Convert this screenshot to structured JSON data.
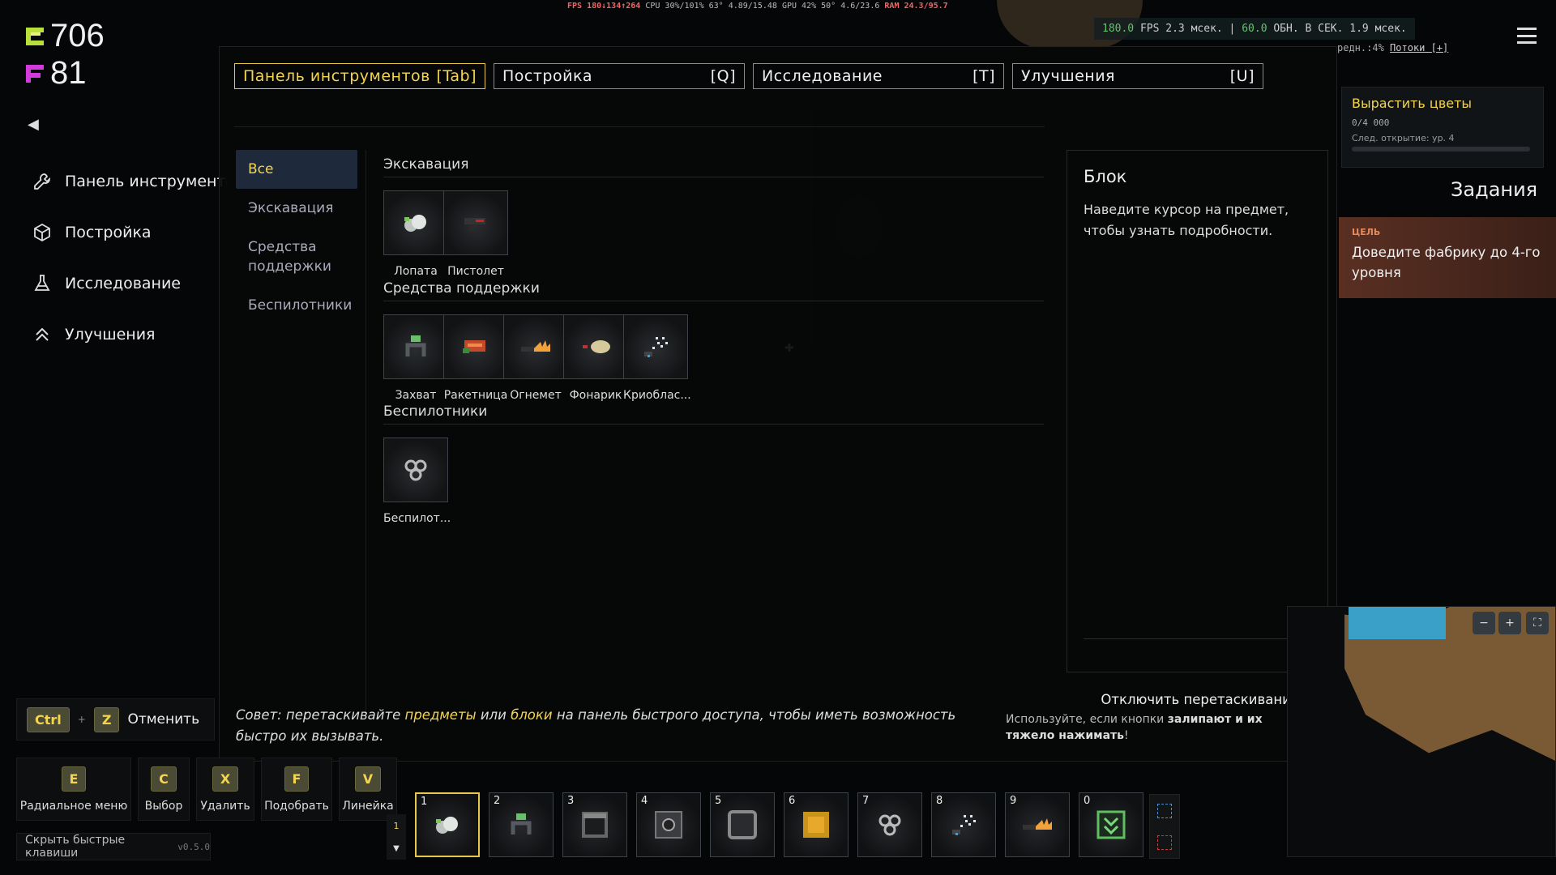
{
  "perf": {
    "fps_line": "FPS 180↓134↑264",
    "cpu_line": "CPU 30%/101% 63°",
    "mem_line": "4.89/15.48",
    "gpu_line": "GPU 42% 50° 4.6/23.6",
    "ram_line": "RAM 24.3/95.7",
    "fps_value": "180.0",
    "fps_label": "FPS",
    "frame_ms": "2.3 мсек.",
    "ups_value": "60.0",
    "ups_label": "ОБН. В СЕК.",
    "update_ms": "1.9 мсек.",
    "sub_text": "редн.:4%",
    "threads_link": "Потоки [+]"
  },
  "resources": {
    "c_value": "706",
    "f_value": "81",
    "c_color": "#b7e03a",
    "f_color": "#d23adc"
  },
  "left_menu": {
    "items": [
      {
        "label": "Панель инструментов",
        "icon": "wrench-icon"
      },
      {
        "label": "Постройка",
        "icon": "cube-icon"
      },
      {
        "label": "Исследование",
        "icon": "flask-icon"
      },
      {
        "label": "Улучшения",
        "icon": "chevrons-up-icon"
      }
    ]
  },
  "tabs": [
    {
      "label": "Панель инструментов",
      "key": "[Tab]"
    },
    {
      "label": "Постройка",
      "key": "[Q]"
    },
    {
      "label": "Исследование",
      "key": "[T]"
    },
    {
      "label": "Улучшения",
      "key": "[U]"
    }
  ],
  "categories": [
    "Все",
    "Экскавация",
    "Средства поддержки",
    "Беспилотники"
  ],
  "sections": {
    "excavation": {
      "title": "Экскавация",
      "items": [
        "Лопата",
        "Пистолет"
      ]
    },
    "support": {
      "title": "Средства поддержки",
      "items": [
        "Захват",
        "Ракетница",
        "Огнемет",
        "Фонарик",
        "Криоблас..."
      ]
    },
    "drones": {
      "title": "Беспилотники",
      "items": [
        "Беспилот..."
      ]
    }
  },
  "detail": {
    "title": "Блок",
    "text": "Наведите курсор на предмет, чтобы узнать подробности."
  },
  "tip": {
    "before": "Совет: перетаскивайте ",
    "hl1": "предметы",
    "mid": " или ",
    "hl2": "блоки",
    "after": " на панель быстрого доступа, чтобы иметь возможность быстро их вызывать."
  },
  "drag": {
    "label": "Отключить перетаскивание",
    "hint_before": "Используйте, если кнопки ",
    "hint_bold": "залипают и их тяжело нажимать",
    "hint_after": "!"
  },
  "goal": {
    "title": "Вырастить цветы",
    "count": "0/4 000",
    "next": "След. открытие: ур. 4",
    "progress": 0
  },
  "tasks": {
    "title": "Задания",
    "label": "ЦЕЛЬ",
    "text": "Доведите фабрику до 4-го уровня"
  },
  "undo": {
    "key1": "Ctrl",
    "key2": "Z",
    "label": "Отменить"
  },
  "hotkeys": [
    {
      "key": "E",
      "label": "Радиальное меню"
    },
    {
      "key": "C",
      "label": "Выбор"
    },
    {
      "key": "X",
      "label": "Удалить"
    },
    {
      "key": "F",
      "label": "Подобрать"
    },
    {
      "key": "V",
      "label": "Линейка"
    }
  ],
  "hide_keys": {
    "label": "Скрыть быстрые клавиши",
    "version": "v0.5.0"
  },
  "hotbar": {
    "page": "1",
    "slots": [
      "1",
      "2",
      "3",
      "4",
      "5",
      "6",
      "7",
      "8",
      "9",
      "0"
    ]
  },
  "minimap": {
    "minus": "−",
    "plus": "+",
    "full": "⛶"
  }
}
